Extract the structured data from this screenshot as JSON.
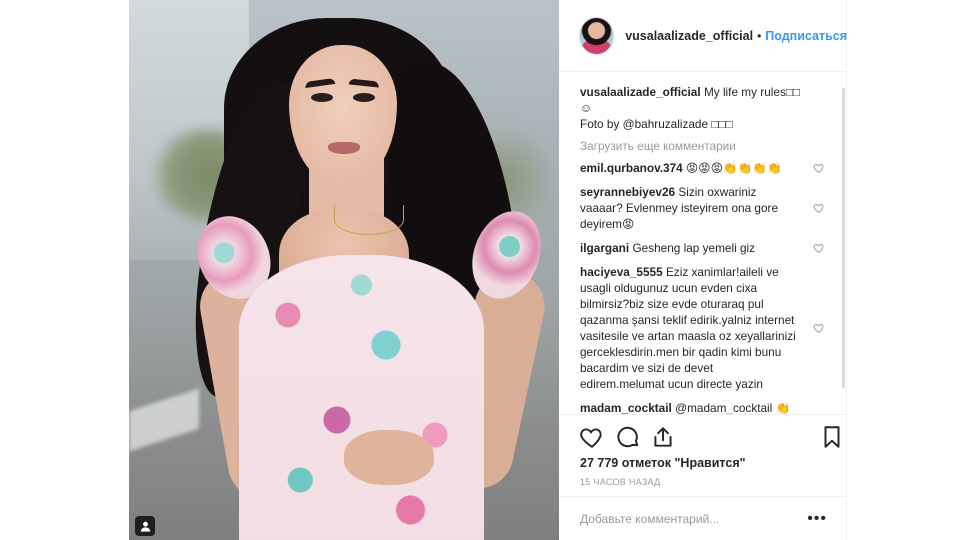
{
  "post": {
    "username": "vusalaalizade_official",
    "separator": "•",
    "follow_label": "Подписаться",
    "caption": {
      "username": "vusalaalizade_official",
      "line1": "My life my rules□□",
      "line2": "☺",
      "line3": "Foto by @bahruzalizade □□□"
    },
    "load_more": "Загрузить еще комментарии",
    "comments": [
      {
        "username": "emil.qurbanov.374",
        "text": "😡😡😡👏👏👏👏"
      },
      {
        "username": "seyrannebiyev26",
        "text": "Sizin oxwariniz vaaaar? Evlenmey isteyirem ona gore deyirem😡"
      },
      {
        "username": "ilgargani",
        "text": "Gesheng lap yemeli giz"
      },
      {
        "username": "haciyeva_5555",
        "text": "Eziz xanimlar!aileli ve usagli oldugunuz ucun evden cixa bilmirsiz?biz size evde oturaraq pul qazanma şansi teklif edirik.yalniz internet vasitesile ve artan maasla oz xeyallarinizi gerceklesdirin.men bir qadin kimi bunu bacardim ve sizi de devet edirem.melumat ucun directe yazin"
      },
      {
        "username": "madam_cocktail",
        "text": "@madam_cocktail 👏"
      }
    ],
    "likes": "27 779 отметок \"Нравится\"",
    "time": "15 ЧАСОВ НАЗАД",
    "add_comment_placeholder": "Добавьте комментарий...",
    "more_label": "•••"
  },
  "icons": [
    "user-tag-icon",
    "heart-icon",
    "comment-icon",
    "share-icon",
    "bookmark-icon",
    "heart-small-icon"
  ]
}
